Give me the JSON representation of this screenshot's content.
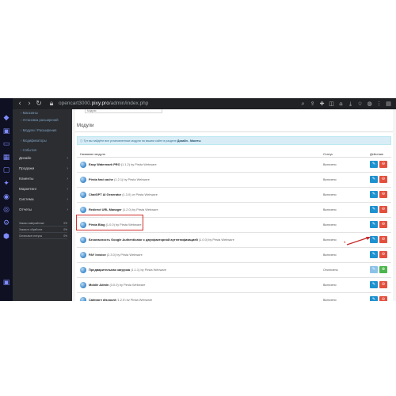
{
  "browser": {
    "url_prefix": "opencart3000.",
    "url_domain": "pixy.pro",
    "url_path": "/admin/index.php"
  },
  "sidebar": {
    "top_items": [
      "Магазины",
      "Установка расширений",
      "Модули / Расширения",
      "Модификаторы",
      "События"
    ],
    "menu": [
      "Дизайн",
      "Продажи",
      "Клиенты",
      "Маркетинг",
      "Система",
      "Отчеты"
    ],
    "stats": [
      {
        "label": "Заказы завершённые",
        "value": "0%",
        "fill": 0.0,
        "color": "#e3503e"
      },
      {
        "label": "Заказы в обработке",
        "value": "0%",
        "fill": 0.0,
        "color": "#f3a638"
      },
      {
        "label": "Остальные статусы",
        "value": "0%",
        "fill": 0.0,
        "color": "#4cb64c"
      }
    ]
  },
  "main": {
    "prev_field_text": "Модули",
    "panel_title": "Модули",
    "alert_text": "Тут вы найдёте все установленные модули на вашем сайте в разделе",
    "alert_link": "Дизайн - Макеты",
    "table": {
      "headers": [
        "Название модуля",
        "Статус",
        "Действие"
      ],
      "rows": [
        {
          "name": "Easy Watermark PRO",
          "version": "(1.1.2) by Pirsta Webware",
          "status": "Включено",
          "installed": true
        },
        {
          "name": "Pirsta fast cache",
          "version": "(1.2.1) by Pirsta Webware",
          "status": "Включено",
          "installed": true
        },
        {
          "name": "ChatGPT AI Generator",
          "version": "(1.3.0) от Pirsta Webware",
          "status": "Включено",
          "installed": true
        },
        {
          "name": "Redirect URL Manager",
          "version": "(1.2.0) by Pirsta Webware",
          "status": "Включено",
          "installed": true
        },
        {
          "name": "Pirsta Blog",
          "version": "(1.0.0) by Pirsta Webware",
          "status": "Включено",
          "installed": true
        },
        {
          "name": "Безопасность Google Authenticator с двухфакторной аутентификацией",
          "version": "(1.0.0) by Pirsta Webware",
          "status": "Включено",
          "installed": true
        },
        {
          "name": "PAY Invoice",
          "version": "(2.3.0) by Pirsta Webware",
          "status": "Включено",
          "installed": true
        },
        {
          "name": "Предварительная загрузка",
          "version": "(1.1.1) by Pirsta Webware",
          "status": "Отключено",
          "installed": false
        },
        {
          "name": "Mobile Admin",
          "version": "(3.0.0) by Pirsta Webware",
          "status": "Включено",
          "installed": true
        },
        {
          "name": "Category discount",
          "version": "(1.2.0) by Pirsta Webware",
          "status": "Включено",
          "installed": true
        }
      ]
    },
    "annotation_number": "1"
  }
}
